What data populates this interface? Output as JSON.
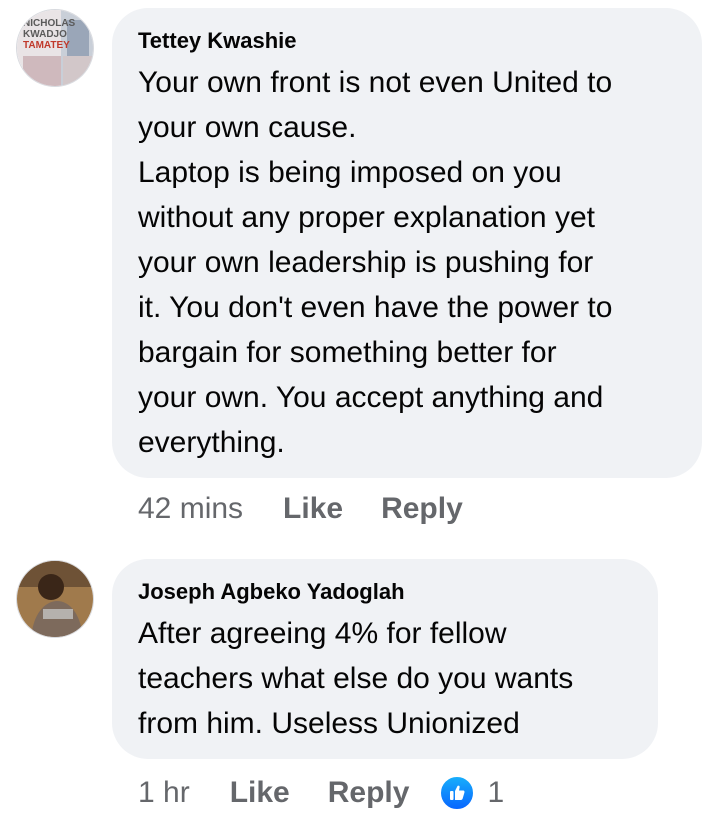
{
  "comments": [
    {
      "author": "Tettey Kwashie",
      "text": "Your own front is not even United to\nyour own cause.\nLaptop is being imposed on you\nwithout any proper explanation yet\nyour own leadership is pushing for\nit. You don't even have the power to\nbargain for something better for\nyour own. You accept anything and\neverything.",
      "time": "42 mins",
      "like_label": "Like",
      "reply_label": "Reply",
      "avatar_text": [
        "NICHOLAS",
        "KWADJO",
        "TAMATEY"
      ]
    },
    {
      "author": "Joseph Agbeko Yadoglah",
      "text": "After agreeing 4% for fellow\nteachers what else do you wants\nfrom him. Useless Unionized",
      "time": "1 hr",
      "like_label": "Like",
      "reply_label": "Reply",
      "reaction_count": "1"
    }
  ],
  "colors": {
    "bubble_bg": "#f0f2f5",
    "text": "#050505",
    "meta": "#65676b",
    "like_blue": "#0866ff"
  },
  "icons": {
    "reaction": "thumbs-up-icon"
  }
}
